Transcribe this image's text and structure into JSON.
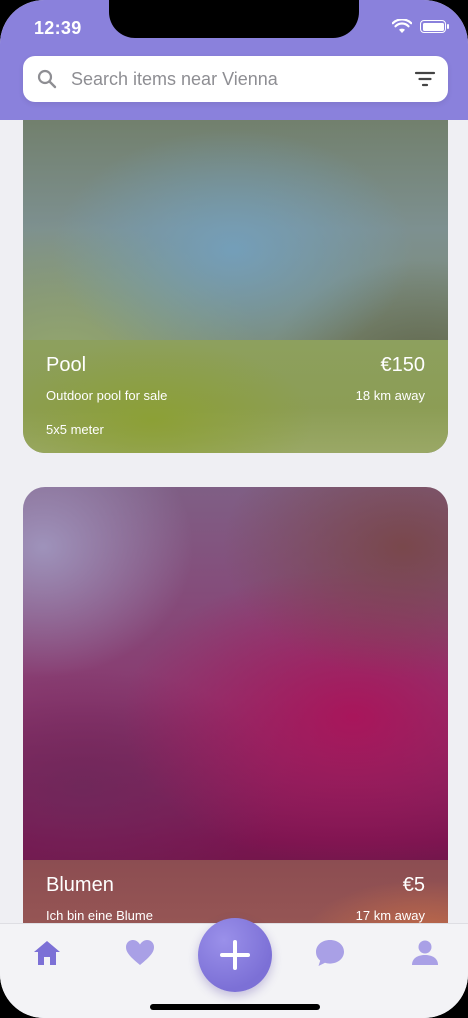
{
  "status_bar": {
    "time": "12:39"
  },
  "search": {
    "placeholder": "Search items near Vienna"
  },
  "listings": [
    {
      "title": "Pool",
      "price": "€150",
      "description": "Outdoor pool for sale",
      "distance": "18 km away",
      "detail": "5x5 meter"
    },
    {
      "title": "Blumen",
      "price": "€5",
      "description": "Ich bin eine Blume",
      "distance": "17 km away"
    }
  ],
  "tabbar": {
    "items": [
      "home-icon",
      "heart-icon",
      "add-icon",
      "chat-icon",
      "profile-icon"
    ],
    "accent": "#7c70d6",
    "inactive": "#a9a0e6"
  },
  "colors": {
    "header": "#8a81dc",
    "background": "#efeff3"
  }
}
